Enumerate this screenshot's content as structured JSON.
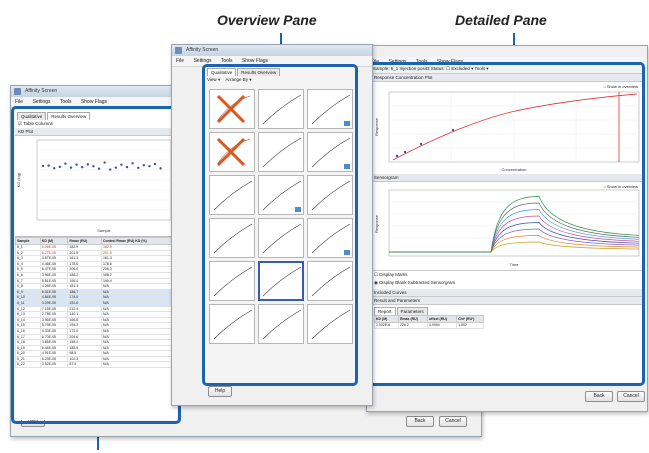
{
  "captions": {
    "overview": "Overview Pane",
    "detailed": "Detailed Pane"
  },
  "left_window": {
    "title": "Affinity Screen",
    "menu": [
      "File",
      "Settings",
      "Tools",
      "Show Flags"
    ],
    "tabs": [
      "Qualitative",
      "Results Overview"
    ],
    "checkbox": "Table Columns",
    "chart_title": "KD Plot",
    "xlabel": "Sample",
    "ylabel": "KD (log)",
    "table_headers": [
      "Sample",
      "KD (M)",
      "Rmax (RU)",
      "Control Rmax (RU) KD (%)"
    ],
    "help": "Help"
  },
  "middle_window": {
    "title": "Affinity Screen",
    "menu": [
      "File",
      "Settings",
      "Tools",
      "Show Flags"
    ],
    "tabs": [
      "Qualitative",
      "Results Overview"
    ],
    "toolbar": [
      "View",
      "Arrange By"
    ],
    "help": "Help",
    "sample_label": "Sample",
    "plot_labels": [
      "Response",
      "Sensorgram"
    ]
  },
  "right_window": {
    "menu": [
      "File",
      "Settings",
      "Tools",
      "Show Flags"
    ],
    "sample_bar": "Sample:  6_1     Injection  posit3     Status:  ☐ Excluded   ▾    Tools ▾",
    "response_title": "Response Concentration Plot",
    "response_xlabel": "Concentration",
    "response_ylabel": "Response",
    "overview_check": "Show in overview",
    "sensorgram_title": "Sensorgram",
    "sensorgram_xlabel": "Time",
    "sensorgram_ylabel": "Response",
    "options": [
      "Display Marks",
      "Display Blank Subtracted Sensorgram"
    ],
    "included_curves": "Included Curves",
    "result_params": "Result and Parameters",
    "result_tabs": [
      "Report",
      "Parameters"
    ],
    "result_headers": [
      "KD (M)",
      "Rmax (RU)",
      "offset (RU)",
      "Chi² (RU²)"
    ],
    "result_row": [
      "1.002E-6",
      "226.2",
      "0.0994",
      "1.502"
    ],
    "buttons": [
      "Back",
      "Cancel"
    ]
  },
  "left_table_rows": [
    [
      "6_1",
      "5.06E-05",
      "182.9",
      "182.9"
    ],
    [
      "6_2",
      "5.27E-05",
      "201.5",
      "201.5"
    ],
    [
      "6_3",
      "3.57E-05",
      "161.3",
      "161.3"
    ],
    [
      "6_4",
      "4.46E-05",
      "178.6",
      "178.6"
    ],
    [
      "6_5",
      "6.47E-05",
      "206.0",
      "206.0"
    ],
    [
      "6_6",
      "3.96E-05",
      "188.2",
      "188.2"
    ],
    [
      "6_7",
      "5.81E-05",
      "195.4",
      "195.4"
    ],
    [
      "6_8",
      "4.26E-05",
      "181.3",
      "N/A"
    ],
    [
      "6_9",
      "6.01E-05",
      "186.7",
      "N/A"
    ],
    [
      "6_10",
      "4.84E-05",
      "174.5",
      "N/A"
    ],
    [
      "6_11",
      "3.29E-05",
      "151.6",
      "N/A"
    ],
    [
      "6_12",
      "7.15E-05",
      "212.4",
      "N/A"
    ],
    [
      "6_13",
      "2.78E-05",
      "140.1",
      "N/A"
    ],
    [
      "6_14",
      "3.96E-05",
      "166.8",
      "N/A"
    ],
    [
      "6_15",
      "5.79E-05",
      "194.3",
      "N/A"
    ],
    [
      "6_16",
      "4.33E-05",
      "172.0",
      "N/A"
    ],
    [
      "6_17",
      "6.70E-05",
      "204.6",
      "N/A"
    ],
    [
      "6_18",
      "3.85E-05",
      "158.2",
      "N/A"
    ],
    [
      "6_19",
      "5.44E-05",
      "188.9",
      "N/A"
    ],
    [
      "6_20",
      "4.91E-05",
      "98.5",
      "N/A"
    ],
    [
      "6_21",
      "6.23E-05",
      "102.3",
      "N/A"
    ],
    [
      "6_22",
      "3.52E-05",
      "87.9",
      "N/A"
    ]
  ],
  "colors": {
    "accent": "#1a63b0",
    "red_mark": "#c0392b"
  }
}
